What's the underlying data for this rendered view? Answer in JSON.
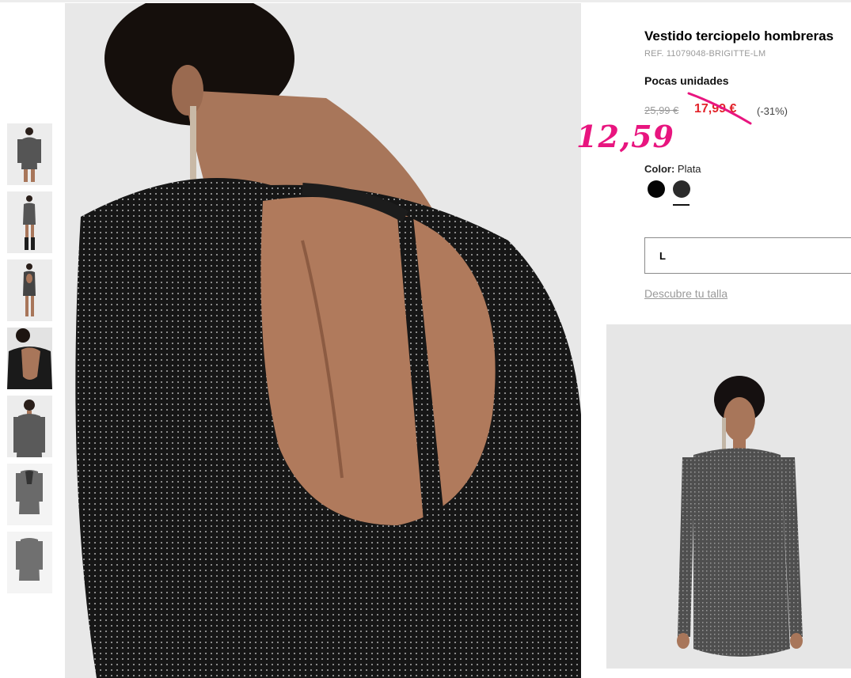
{
  "product": {
    "title": "Vestido terciopelo hombreras",
    "ref": "REF. 11079048-BRIGITTE-LM",
    "stock_status": "Pocas unidades",
    "price_original": "25,99 €",
    "price_sale": "17,99 €",
    "discount": "(-31%)",
    "handwritten_price": "12,59",
    "color_label": "Color:",
    "color_value": "Plata",
    "swatches": [
      "black-swatch",
      "silver-swatch"
    ],
    "size_selected": "L",
    "size_guide_link": "Descubre tu talla"
  },
  "colors": {
    "sale_red": "#e2232a",
    "annotation_pink": "#e8157f",
    "muted_gray": "#9a9a9a",
    "dress_dark": "#1a1a1a",
    "dress_gray": "#5e5e5e",
    "skin": "#a8765a"
  },
  "gallery": {
    "thumbnails": [
      "front-view",
      "full-body-boots",
      "back-full",
      "back-detail",
      "upper-front",
      "pack-shot-back",
      "pack-shot-front"
    ],
    "selected_thumbnail": "back-detail"
  }
}
